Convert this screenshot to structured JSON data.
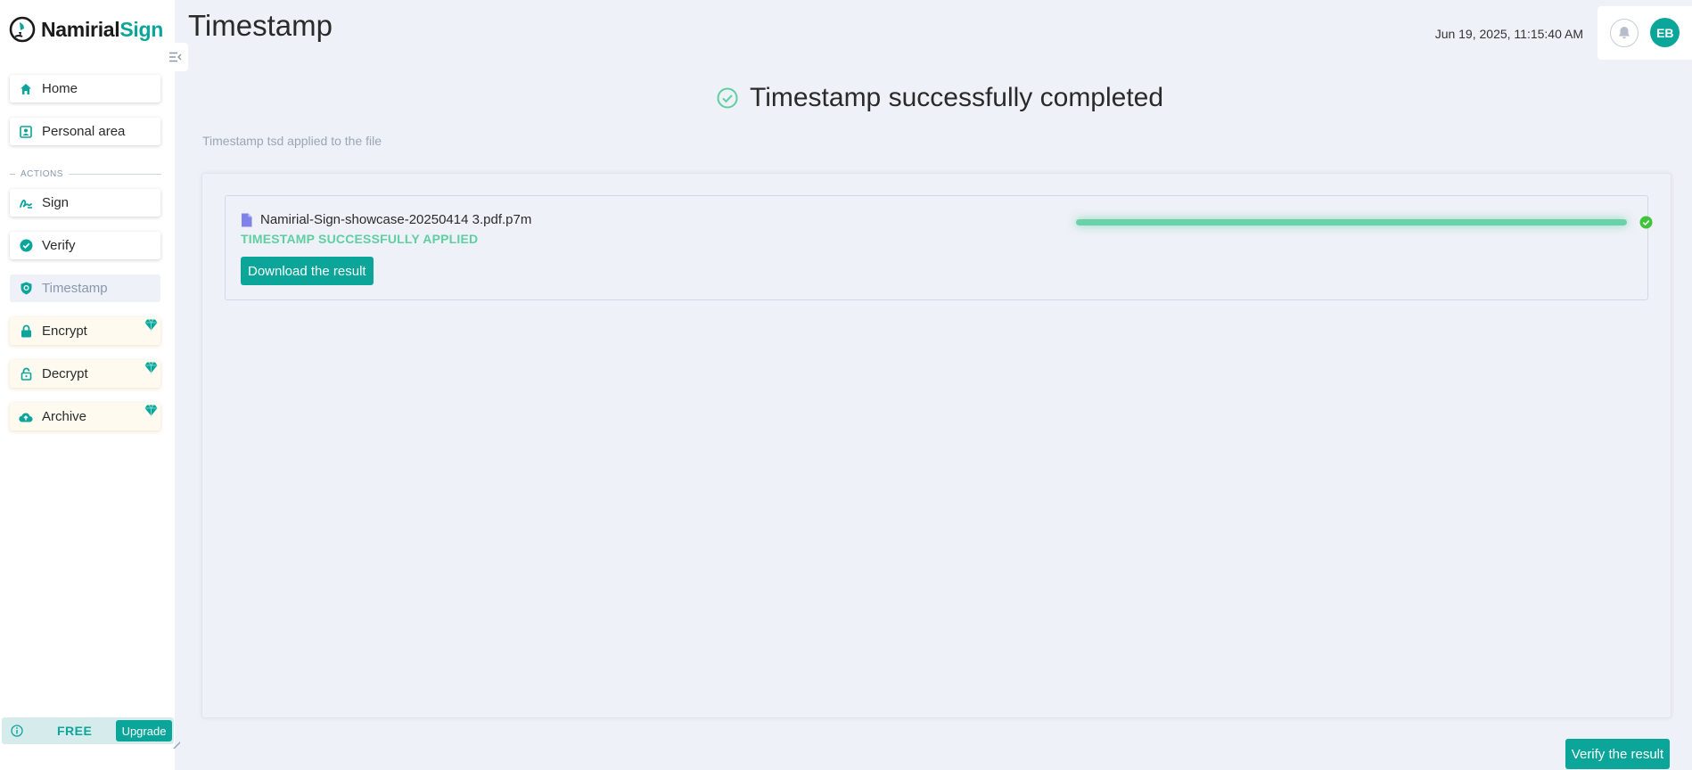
{
  "app": {
    "logo_text_main": "Namirial",
    "logo_text_accent": "Sign",
    "accent_color": "#0ba59a"
  },
  "sidebar": {
    "items": [
      {
        "label": "Home",
        "icon": "home-icon"
      },
      {
        "label": "Personal area",
        "icon": "person-card-icon"
      }
    ],
    "section_label": "ACTIONS",
    "actions": [
      {
        "label": "Sign",
        "icon": "signature-icon",
        "state": "normal"
      },
      {
        "label": "Verify",
        "icon": "verified-badge-icon",
        "state": "normal"
      },
      {
        "label": "Timestamp",
        "icon": "shield-icon",
        "state": "active"
      },
      {
        "label": "Encrypt",
        "icon": "lock-icon",
        "state": "premium"
      },
      {
        "label": "Decrypt",
        "icon": "unlock-icon",
        "state": "premium"
      },
      {
        "label": "Archive",
        "icon": "cloud-upload-icon",
        "state": "premium"
      }
    ],
    "plan": {
      "label": "FREE",
      "upgrade_label": "Upgrade",
      "icon": "info-icon"
    }
  },
  "header": {
    "title": "Timestamp",
    "datetime": "Jun 19, 2025, 11:15:40 AM",
    "avatar_initials": "EB",
    "bell_icon": "bell-icon"
  },
  "main": {
    "success_text": "Timestamp successfully completed",
    "subtitle": "Timestamp tsd applied to the file",
    "file": {
      "name": "Namirial-Sign-showcase-20250414 3.pdf.p7m",
      "status": "TIMESTAMP SUCCESSFULLY APPLIED",
      "progress": 1.0,
      "download_label": "Download the result"
    },
    "verify_label": "Verify the result"
  }
}
